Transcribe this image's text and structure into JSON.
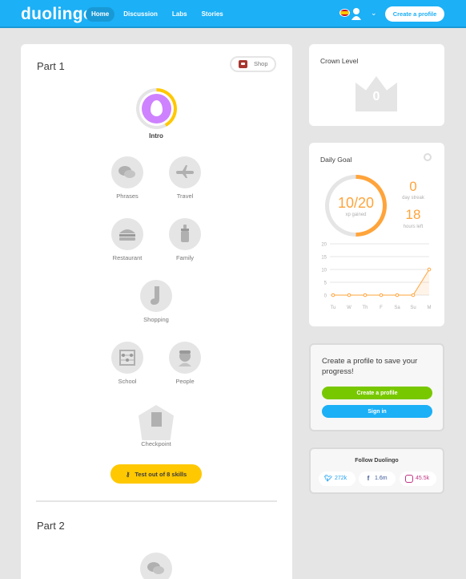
{
  "header": {
    "logo": "duolingo",
    "nav": [
      "Home",
      "Discussion",
      "Labs",
      "Stories"
    ],
    "create_profile": "Create a profile",
    "colors": {
      "brand": "#1cb0f6",
      "active_tab": "#1899d6"
    }
  },
  "main": {
    "part1_title": "Part 1",
    "shop_label": "Shop",
    "intro_label": "Intro",
    "skills": [
      "Phrases",
      "Travel",
      "Restaurant",
      "Family",
      "Shopping",
      "School",
      "People"
    ],
    "checkpoint_label": "Checkpoint",
    "test_out_label": "Test out of 8 skills",
    "part2_title": "Part 2"
  },
  "crown": {
    "title": "Crown Level",
    "value": "0"
  },
  "daily_goal": {
    "title": "Daily Goal",
    "xp_display": "10/20",
    "xp_sub": "xp gained",
    "progress": 0.5,
    "streak_value": "0",
    "streak_label": "day streak",
    "hours_value": "18",
    "hours_label": "hours left",
    "accent": "#ffa43b"
  },
  "chart_data": {
    "type": "line",
    "categories": [
      "Tu",
      "W",
      "Th",
      "F",
      "Sa",
      "Su",
      "M"
    ],
    "values": [
      0,
      0,
      0,
      0,
      0,
      0,
      10
    ],
    "yticks": [
      0,
      5,
      10,
      15,
      20
    ],
    "ylim": [
      0,
      20
    ],
    "grid": true
  },
  "cta": {
    "text": "Create a profile to save your progress!",
    "create_label": "Create a profile",
    "signin_label": "Sign in"
  },
  "follow": {
    "title": "Follow Duolingo",
    "twitter": "272k",
    "facebook": "1.6m",
    "instagram": "45.5k"
  }
}
